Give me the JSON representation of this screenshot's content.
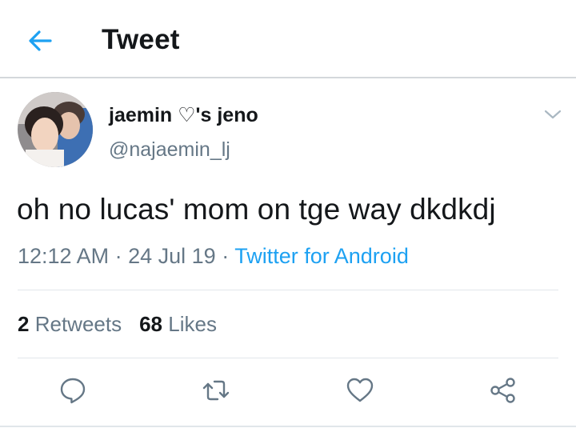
{
  "header": {
    "title": "Tweet",
    "back_icon": "arrow-left-icon",
    "accent_color": "#1da1f2"
  },
  "tweet": {
    "display_name": "jaemin ♡'s jeno",
    "handle": "@najaemin_lj",
    "text": "oh no lucas' mom on tge way dkdkdj",
    "time": "12:12 AM",
    "separator": "·",
    "date": "24 Jul 19",
    "source": "Twitter for Android"
  },
  "stats": {
    "retweets_count": "2",
    "retweets_label": "Retweets",
    "likes_count": "68",
    "likes_label": "Likes"
  },
  "actions": [
    "reply-icon",
    "retweet-icon",
    "like-icon",
    "share-icon"
  ]
}
